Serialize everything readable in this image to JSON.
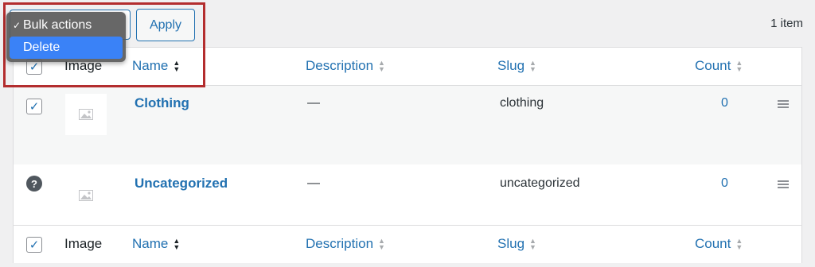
{
  "toolbar": {
    "bulk_actions_menu": [
      {
        "label": "Bulk actions",
        "checked": true
      },
      {
        "label": "Delete",
        "highlighted": true
      }
    ],
    "apply_label": "Apply",
    "item_count": "1 item",
    "check_mark": "✓"
  },
  "table": {
    "columns": {
      "image": "Image",
      "name": "Name",
      "description": "Description",
      "slug": "Slug",
      "count": "Count"
    },
    "rows": [
      {
        "name": "Clothing",
        "description": "—",
        "slug": "clothing",
        "count": "0",
        "status_icon": "checkbox-checked"
      },
      {
        "name": "Uncategorized",
        "description": "—",
        "slug": "uncategorized",
        "count": "0",
        "status_icon": "help-icon"
      }
    ],
    "help_glyph": "?"
  },
  "colors": {
    "accent": "#2271b1",
    "highlight_border": "#b32d2e",
    "menu_highlight": "#3a82f7"
  }
}
